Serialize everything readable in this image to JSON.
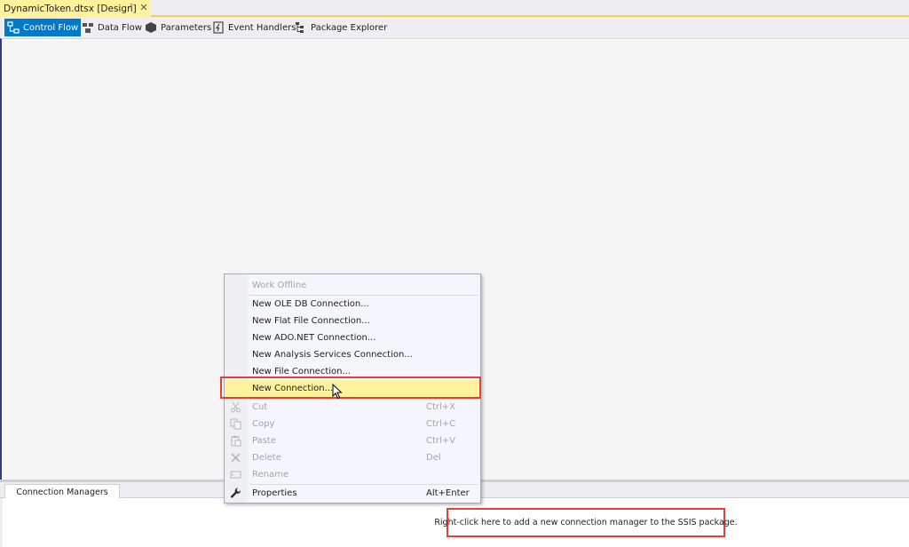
{
  "document_tab": {
    "title": "DynamicToken.dtsx [Design]",
    "pin_icon": "pin-icon",
    "close_icon": "close-icon"
  },
  "toolbar": {
    "items": [
      {
        "label": "Control Flow",
        "icon": "control-flow-icon",
        "active": true
      },
      {
        "label": "Data Flow",
        "icon": "data-flow-icon",
        "active": false
      },
      {
        "label": "Parameters",
        "icon": "parameters-icon",
        "active": false
      },
      {
        "label": "Event Handlers",
        "icon": "event-handlers-icon",
        "active": false
      },
      {
        "label": "Package Explorer",
        "icon": "package-explorer-icon",
        "active": false
      }
    ]
  },
  "context_menu": {
    "items": [
      {
        "label": "Work Offline",
        "shortcut": "",
        "disabled": true,
        "icon": ""
      },
      {
        "label": "New OLE DB Connection...",
        "shortcut": "",
        "disabled": false,
        "icon": ""
      },
      {
        "label": "New Flat File Connection...",
        "shortcut": "",
        "disabled": false,
        "icon": ""
      },
      {
        "label": "New ADO.NET Connection...",
        "shortcut": "",
        "disabled": false,
        "icon": ""
      },
      {
        "label": "New Analysis Services Connection...",
        "shortcut": "",
        "disabled": false,
        "icon": ""
      },
      {
        "label": "New File Connection...",
        "shortcut": "",
        "disabled": false,
        "icon": ""
      },
      {
        "label": "New Connection...",
        "shortcut": "",
        "disabled": false,
        "icon": "",
        "highlighted": true
      },
      {
        "label": "Cut",
        "shortcut": "Ctrl+X",
        "disabled": true,
        "icon": "cut-icon"
      },
      {
        "label": "Copy",
        "shortcut": "Ctrl+C",
        "disabled": true,
        "icon": "copy-icon"
      },
      {
        "label": "Paste",
        "shortcut": "Ctrl+V",
        "disabled": true,
        "icon": "paste-icon"
      },
      {
        "label": "Delete",
        "shortcut": "Del",
        "disabled": true,
        "icon": "delete-icon"
      },
      {
        "label": "Rename",
        "shortcut": "",
        "disabled": true,
        "icon": "rename-icon"
      },
      {
        "label": "Properties",
        "shortcut": "Alt+Enter",
        "disabled": false,
        "icon": "wrench-icon"
      }
    ]
  },
  "connection_managers": {
    "tab_label": "Connection Managers",
    "hint": "Right-click here to add a new connection manager to the SSIS package."
  },
  "colors": {
    "accent": "#0079cb",
    "tab_highlight": "#fff29d",
    "callout": "#e2403a"
  }
}
